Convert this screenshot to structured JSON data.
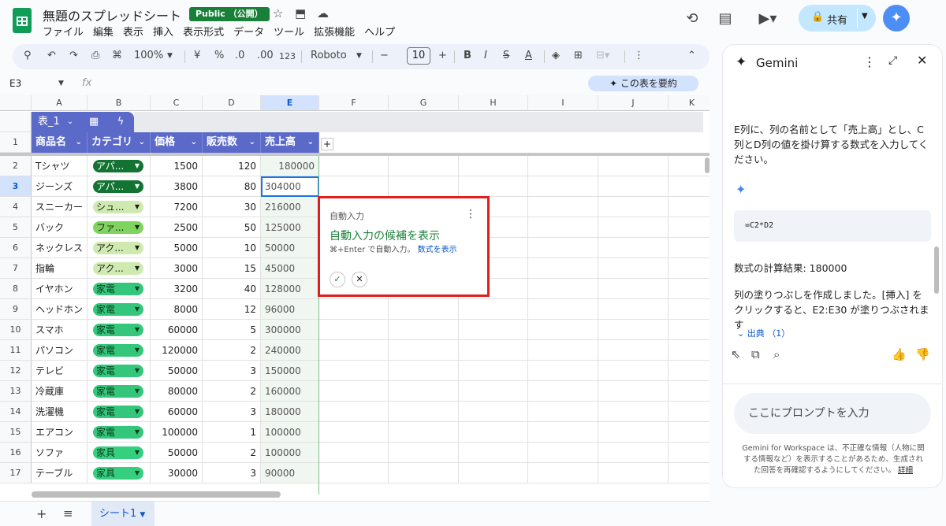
{
  "doc": {
    "title": "無題のスプレッドシート",
    "badge": "Public （公開）",
    "menu": [
      "ファイル",
      "編集",
      "表示",
      "挿入",
      "表示形式",
      "データ",
      "ツール",
      "拡張機能",
      "ヘルプ"
    ],
    "share_label": "共有"
  },
  "toolbar": {
    "zoom": "100%",
    "currency": "¥",
    "percent": "%",
    "dec_less": ".0",
    "dec_more": ".00",
    "num_format": "123",
    "font": "Roboto",
    "font_size": "10"
  },
  "formula": {
    "name_box": "E3",
    "fx": "fx",
    "summary_button": "✦ この表を要約"
  },
  "grid": {
    "columns": [
      "A",
      "B",
      "C",
      "D",
      "E",
      "F",
      "G",
      "H",
      "I",
      "J",
      "K"
    ],
    "table_name": "表_1",
    "headers": [
      "商品名",
      "カテゴリ",
      "価格",
      "販売数",
      "売上高"
    ],
    "rows": [
      {
        "num": "2",
        "name": "Tシャツ",
        "cat": "アパ...",
        "price": "1500",
        "qty": "120",
        "sales": "180000"
      },
      {
        "num": "3",
        "name": "ジーンズ",
        "cat": "アパ...",
        "price": "3800",
        "qty": "80",
        "sales": "304000"
      },
      {
        "num": "4",
        "name": "スニーカー",
        "cat": "シュ...",
        "price": "7200",
        "qty": "30",
        "sales": "216000"
      },
      {
        "num": "5",
        "name": "バック",
        "cat": "ファ...",
        "price": "2500",
        "qty": "50",
        "sales": "125000"
      },
      {
        "num": "6",
        "name": "ネックレス",
        "cat": "アク...",
        "price": "5000",
        "qty": "10",
        "sales": "50000"
      },
      {
        "num": "7",
        "name": "指輪",
        "cat": "アク...",
        "price": "3000",
        "qty": "15",
        "sales": "45000"
      },
      {
        "num": "8",
        "name": "イヤホン",
        "cat": "家電",
        "price": "3200",
        "qty": "40",
        "sales": "128000"
      },
      {
        "num": "9",
        "name": "ヘッドホン",
        "cat": "家電",
        "price": "8000",
        "qty": "12",
        "sales": "96000"
      },
      {
        "num": "10",
        "name": "スマホ",
        "cat": "家電",
        "price": "60000",
        "qty": "5",
        "sales": "300000"
      },
      {
        "num": "11",
        "name": "パソコン",
        "cat": "家電",
        "price": "120000",
        "qty": "2",
        "sales": "240000"
      },
      {
        "num": "12",
        "name": "テレビ",
        "cat": "家電",
        "price": "50000",
        "qty": "3",
        "sales": "150000"
      },
      {
        "num": "13",
        "name": "冷蔵庫",
        "cat": "家電",
        "price": "80000",
        "qty": "2",
        "sales": "160000"
      },
      {
        "num": "14",
        "name": "洗濯機",
        "cat": "家電",
        "price": "60000",
        "qty": "3",
        "sales": "180000"
      },
      {
        "num": "15",
        "name": "エアコン",
        "cat": "家電",
        "price": "100000",
        "qty": "1",
        "sales": "100000"
      },
      {
        "num": "16",
        "name": "ソファ",
        "cat": "家具",
        "price": "50000",
        "qty": "2",
        "sales": "100000"
      },
      {
        "num": "17",
        "name": "テーブル",
        "cat": "家具",
        "price": "30000",
        "qty": "3",
        "sales": "90000"
      }
    ],
    "chip_colors": {
      "アパ...": "#137333",
      "シュ...": "#ceeab0",
      "ファ...": "#7fd35e",
      "アク...": "#ceeab0",
      "家電": "#34c77b",
      "家具": "#35d07f"
    }
  },
  "popup": {
    "header": "自動入力",
    "title": "自動入力の候補を表示",
    "hint": "⌘+Enter で自動入力。",
    "hint_link": "数式を表示"
  },
  "sheet": {
    "tab": "シート1"
  },
  "gemini": {
    "title": "Gemini",
    "msg1": "E列に、列の名前として「売上高」とし、C列とD列の値を掛け算する数式を入力してください。",
    "code": "=C2*D2",
    "result": "数式の計算結果: 180000",
    "msg2": "列の塗りつぶしを作成しました。[挿入] をクリックすると、E2:E30 が塗りつぶされます",
    "sources": "出典 （1）",
    "prompt_placeholder": "ここにプロンプトを入力",
    "disclaimer": "Gemini for Workspace は、不正確な情報（人物に関する情報など）を表示することがあるため、生成された回答を再確認するようにしてください。",
    "disclaimer_link": "詳細"
  }
}
